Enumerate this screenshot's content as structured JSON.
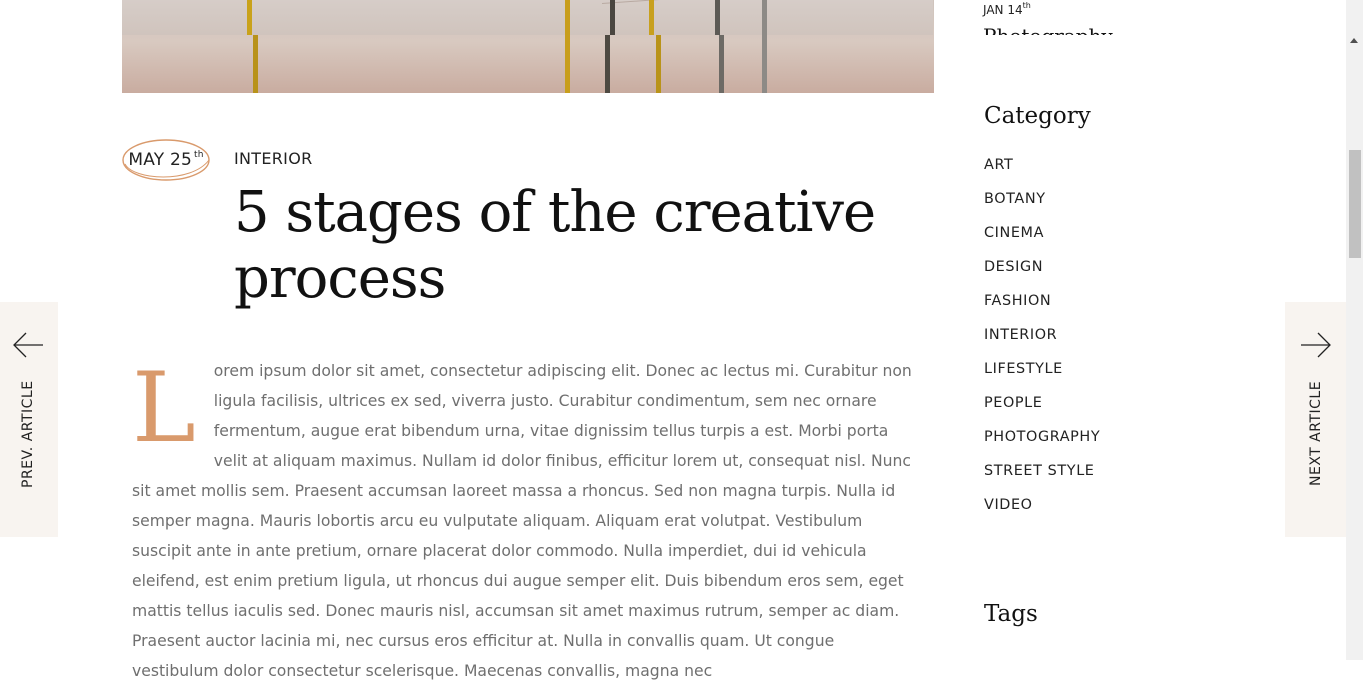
{
  "post": {
    "date_month_day": "MAY 25",
    "date_suffix": "th",
    "category": "INTERIOR",
    "title": "5 stages of the creative process",
    "drop_cap": "L",
    "body": "orem ipsum dolor sit amet, consectetur adipiscing elit. Donec ac lectus mi. Curabitur non ligula facilisis, ultrices ex sed, viverra justo. Curabitur condimentum, sem nec ornare fermentum, augue erat bibendum urna, vitae dignissim tellus turpis a est. Morbi porta velit at aliquam maximus. Nullam id dolor finibus, efficitur lorem ut, consequat nisl. Nunc sit amet mollis sem. Praesent accumsan laoreet massa a rhoncus. Sed non magna turpis. Nulla id semper magna. Mauris lobortis arcu eu vulputate aliquam. Aliquam erat volutpat. Vestibulum suscipit ante in ante pretium, ornare placerat dolor commodo. Nulla imperdiet, dui id vehicula eleifend, est enim pretium ligula, ut rhoncus dui augue semper elit. Duis bibendum eros sem, eget mattis tellus iaculis sed. Donec mauris nisl, accumsan sit amet maximus rutrum, semper ac diam. Praesent auctor lacinia mi, nec cursus eros efficitur at. Nulla in convallis quam. Ut congue vestibulum dolor consectetur scelerisque. Maecenas convallis, magna nec"
  },
  "navigation": {
    "prev_label": "PREV. ARTICLE",
    "next_label": "NEXT ARTICLE",
    "prev_icon": "arrow-left-icon",
    "next_icon": "arrow-right-icon"
  },
  "sidebar": {
    "recent_post": {
      "date": "JAN 14",
      "date_suffix": "th",
      "category_partial": "Photography"
    },
    "category_title": "Category",
    "categories": [
      "ART",
      "BOTANY",
      "CINEMA",
      "DESIGN",
      "FASHION",
      "INTERIOR",
      "LIFESTYLE",
      "PEOPLE",
      "PHOTOGRAPHY",
      "STREET STYLE",
      "VIDEO"
    ],
    "tags_title": "Tags"
  },
  "colors": {
    "accent": "#d99a6c",
    "body_text": "#6f6f6f",
    "heading": "#111111",
    "nav_background": "#f8f4f0"
  }
}
